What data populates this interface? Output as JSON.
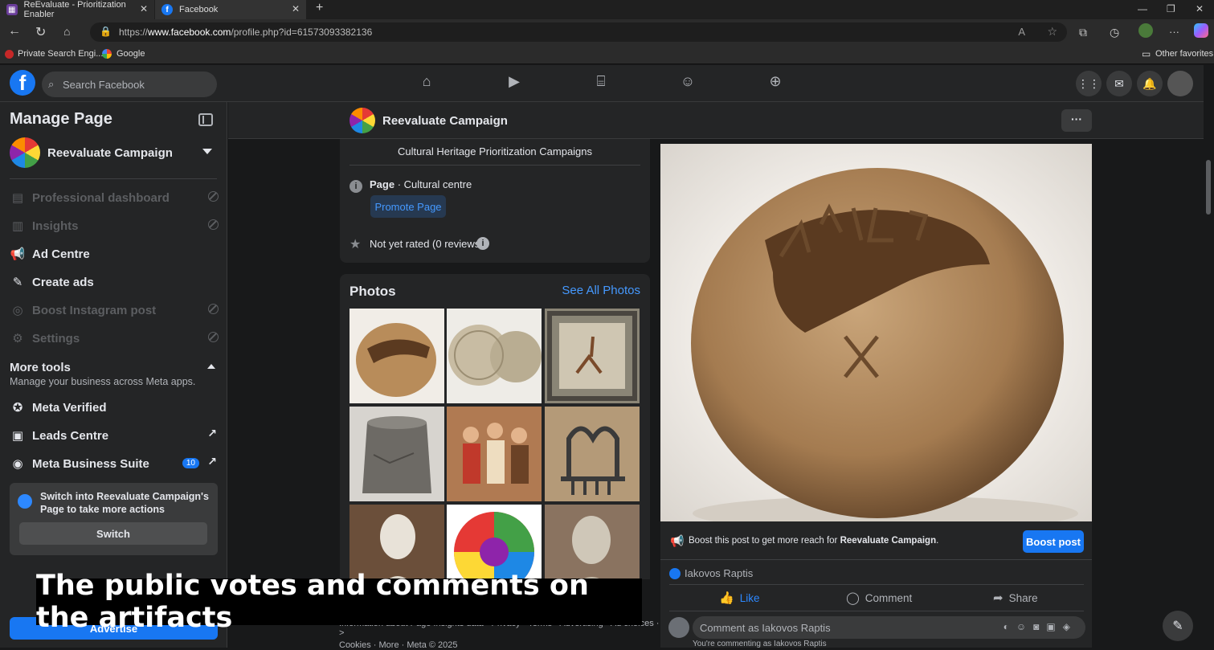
{
  "browser": {
    "tabs": [
      {
        "title": "ReEvaluate - Prioritization Enabler"
      },
      {
        "title": "Facebook"
      }
    ],
    "url_prefix": "https://",
    "url_host": "www.facebook.com",
    "url_path": "/profile.php?id=61573093382136",
    "favorites": [
      {
        "label": "Private Search Engi..."
      },
      {
        "label": "Google"
      }
    ],
    "other_favorites": "Other favorites"
  },
  "fb": {
    "search_placeholder": "Search Facebook"
  },
  "sidebar": {
    "title": "Manage Page",
    "page_name": "Reevaluate Campaign",
    "items": [
      {
        "label": "Professional dashboard",
        "disabled": true
      },
      {
        "label": "Insights",
        "disabled": true
      },
      {
        "label": "Ad Centre",
        "disabled": false
      },
      {
        "label": "Create ads",
        "disabled": false
      },
      {
        "label": "Boost Instagram post",
        "disabled": true
      },
      {
        "label": "Settings",
        "disabled": true
      }
    ],
    "more_tools": "More tools",
    "more_tools_sub": "Manage your business across Meta apps.",
    "tools": [
      {
        "label": "Meta Verified"
      },
      {
        "label": "Leads Centre"
      },
      {
        "label": "Meta Business Suite",
        "badge": "10"
      }
    ],
    "switch_msg": "Switch into Reevaluate Campaign's Page to take more actions",
    "switch_btn": "Switch",
    "advertise": "Advertise"
  },
  "page_header": {
    "name": "Reevaluate Campaign",
    "more": "···"
  },
  "intro": {
    "tagline": "Cultural Heritage Prioritization Campaigns",
    "category_bold": "Page",
    "category_rest": " · Cultural centre",
    "promote": "Promote Page",
    "rating": "Not yet rated (0 reviews)"
  },
  "photos": {
    "title": "Photos",
    "see_all": "See All Photos"
  },
  "footer": {
    "line1": "Information about Page Insights data · Privacy · Terms · Advertising · Ad choices · >",
    "line2": "Cookies · More · Meta © 2025"
  },
  "post": {
    "boost_msg_pre": "Boost this post to get more reach for ",
    "boost_msg_page": "Reevaluate Campaign",
    "boost_msg_post": ".",
    "boost_btn": "Boost post",
    "reactor": "Iakovos Raptis",
    "actions": {
      "like": "Like",
      "comment": "Comment",
      "share": "Share"
    },
    "comment_placeholder": "Comment as Iakovos Raptis",
    "comment_note": "You're commenting as Iakovos Raptis"
  },
  "caption": "The public votes and comments on the artifacts"
}
